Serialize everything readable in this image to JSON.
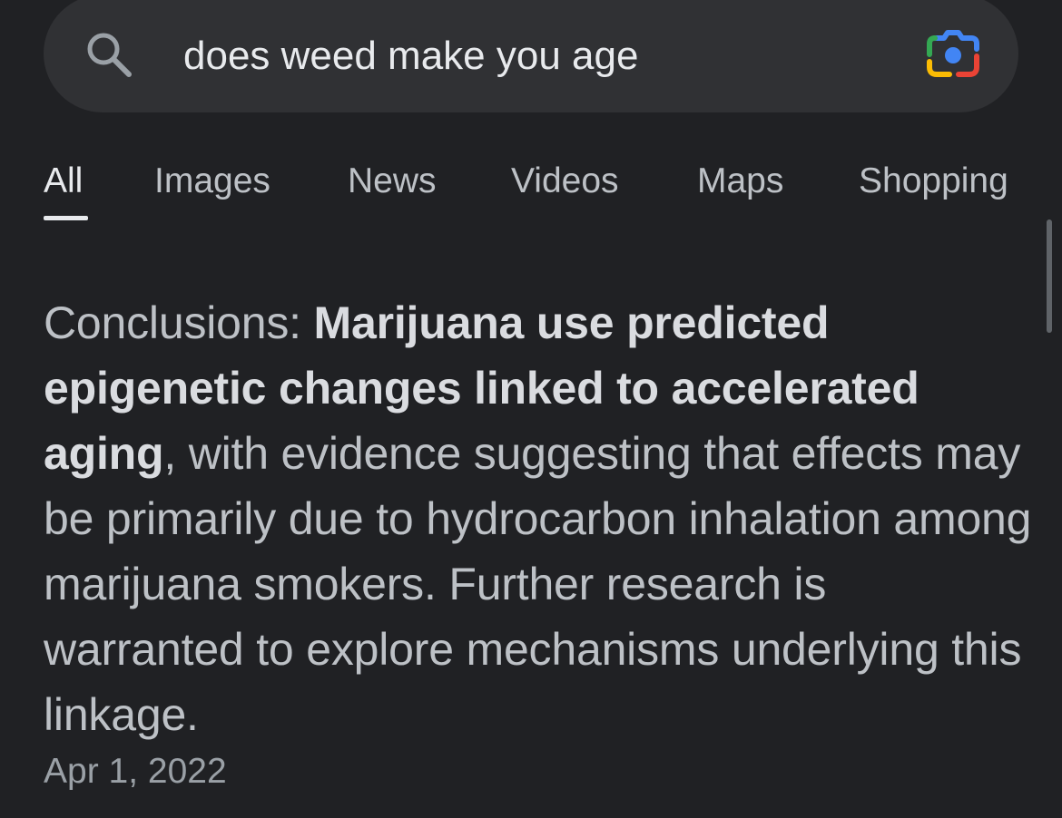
{
  "search": {
    "query": "does weed make you age",
    "icon": "search-icon",
    "lens_icon": "google-lens-icon"
  },
  "tabs": [
    {
      "label": "All",
      "active": true
    },
    {
      "label": "Images",
      "active": false
    },
    {
      "label": "News",
      "active": false
    },
    {
      "label": "Videos",
      "active": false
    },
    {
      "label": "Maps",
      "active": false
    },
    {
      "label": "Shopping",
      "active": false
    }
  ],
  "snippet": {
    "prefix": "Conclusions: ",
    "highlight": "Marijuana use predicted epigenetic changes linked to accelerated aging",
    "rest": ", with evidence suggesting that effects may be primarily due to hydrocarbon inhalation among marijuana smokers. Further research is warranted to explore mechanisms underlying this linkage.",
    "date": "Apr 1, 2022"
  },
  "colors": {
    "background": "#202124",
    "search_bar": "#303134",
    "text_primary": "#e8eaed",
    "text_secondary": "#bdc1c6",
    "lens_blue": "#4285f4",
    "lens_red": "#ea4335",
    "lens_yellow": "#fbbc04",
    "lens_green": "#34a853"
  }
}
